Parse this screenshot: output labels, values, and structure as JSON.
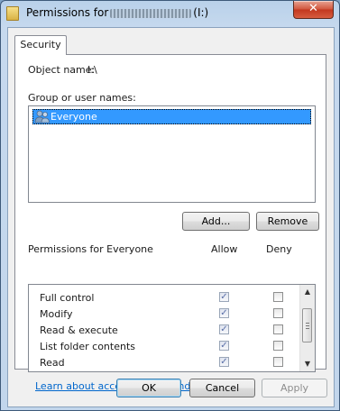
{
  "window": {
    "title_prefix": "Permissions for",
    "title_suffix": "(I:)",
    "close_glyph": "✕"
  },
  "tabs": [
    {
      "label": "Security"
    }
  ],
  "object": {
    "label": "Object name:",
    "value": "I:\\"
  },
  "group": {
    "label": "Group or user names:",
    "items": [
      {
        "label": "Everyone",
        "icon": "users-icon",
        "selected": true
      }
    ],
    "add_button": "Add...",
    "remove_button": "Remove"
  },
  "permissions": {
    "header": "Permissions for Everyone",
    "allow_header": "Allow",
    "deny_header": "Deny",
    "rows": [
      {
        "name": "Full control",
        "allow": true,
        "deny": false
      },
      {
        "name": "Modify",
        "allow": true,
        "deny": false
      },
      {
        "name": "Read & execute",
        "allow": true,
        "deny": false
      },
      {
        "name": "List folder contents",
        "allow": true,
        "deny": false
      },
      {
        "name": "Read",
        "allow": true,
        "deny": false
      },
      {
        "name": "",
        "allow": true,
        "deny": false
      }
    ]
  },
  "link": "Learn about access control and permissions",
  "buttons": {
    "ok": "OK",
    "cancel": "Cancel",
    "apply": "Apply"
  },
  "colors": {
    "selection": "#3399ff",
    "link": "#0066cc",
    "close": "#c2371e"
  }
}
